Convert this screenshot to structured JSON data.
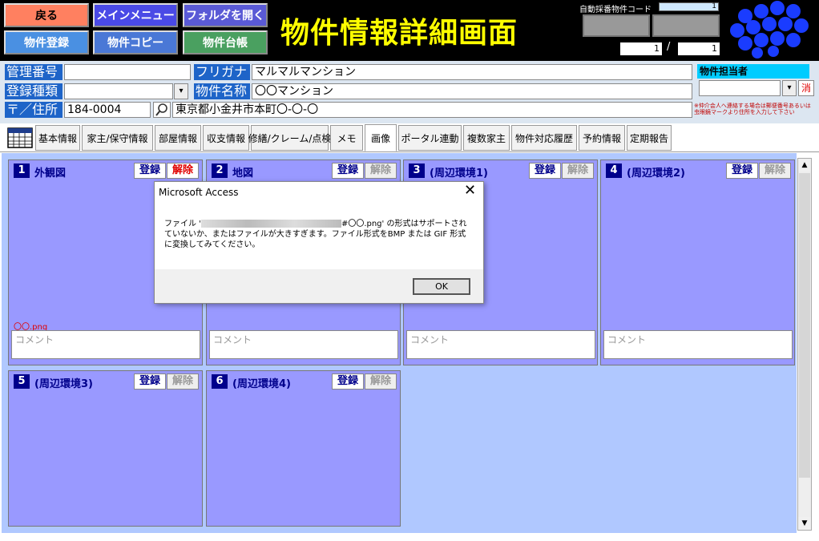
{
  "header": {
    "nav_buttons": [
      {
        "label": "戻る",
        "bg": "#ff8060",
        "color": "#000"
      },
      {
        "label": "メインメニュー",
        "bg": "#4a4ae6",
        "color": "#ffffff"
      },
      {
        "label": "フォルダを開く",
        "bg": "#5a5ad6",
        "color": "#ffffff"
      },
      {
        "label": "物件登録",
        "bg": "#4a90e2",
        "color": "#ffffff"
      },
      {
        "label": "物件コピー",
        "bg": "#4a78d6",
        "color": "#ffffff"
      },
      {
        "label": "物件台帳",
        "bg": "#4aa060",
        "color": "#ffffff"
      }
    ],
    "title": "物件情報詳細画面",
    "auto_code_label": "自動採番物件コード",
    "auto_code_value": "1",
    "page_current": "1",
    "page_sep": "/",
    "page_total": "1"
  },
  "form": {
    "mgmt_no_label": "管理番号",
    "mgmt_no_value": "",
    "furigana_label": "フリガナ",
    "furigana_value": "マルマルマンション",
    "manager_label": "物件担当者",
    "manager_value": "",
    "manager_clear": "消",
    "reg_type_label": "登録種類",
    "reg_type_value": "",
    "prop_name_label": "物件名称",
    "prop_name_value": "〇〇マンション",
    "zip_label": "〒／住所",
    "zip_value": "184-0004",
    "address_value": "東京都小金井市本町〇-〇-〇",
    "note": "※仲介会人へ連絡する場合は郵便番号あるいは虫眼鏡マークより住所を入力して下さい"
  },
  "tabs": [
    "基本情報",
    "家主/保守情報",
    "部屋情報",
    "収支情報",
    "修繕/クレーム/点検",
    "メモ",
    "画像",
    "ポータル連動",
    "複数家主",
    "物件対応履歴",
    "予約情報",
    "定期報告"
  ],
  "active_tab": "画像",
  "panels": [
    {
      "num": "1",
      "title": "外観図",
      "register": "登録",
      "release": "解除",
      "release_active": true,
      "file": "〇〇.png",
      "comment": "コメント"
    },
    {
      "num": "2",
      "title": "地図",
      "register": "登録",
      "release": "解除",
      "release_active": false,
      "file": "",
      "comment": "コメント"
    },
    {
      "num": "3",
      "title": "(周辺環境1)",
      "register": "登録",
      "release": "解除",
      "release_active": false,
      "file": "",
      "comment": "コメント"
    },
    {
      "num": "4",
      "title": "(周辺環境2)",
      "register": "登録",
      "release": "解除",
      "release_active": false,
      "file": "",
      "comment": "コメント"
    },
    {
      "num": "5",
      "title": "(周辺環境3)",
      "register": "登録",
      "release": "解除",
      "release_active": false,
      "file": "",
      "comment": ""
    },
    {
      "num": "6",
      "title": "(周辺環境4)",
      "register": "登録",
      "release": "解除",
      "release_active": false,
      "file": "",
      "comment": ""
    }
  ],
  "dialog": {
    "title": "Microsoft Access",
    "close": "✕",
    "message_prefix": "ファイル '",
    "message_suffix": "#〇〇.png' の形式はサポートされていないか、またはファイルが大きすぎます。ファイル形式をBMP または GIF 形式に変換してみてください。",
    "ok": "OK"
  },
  "icons": {
    "calendar": "calendar-icon",
    "search": "search-icon",
    "logo": "dots-logo-icon"
  }
}
